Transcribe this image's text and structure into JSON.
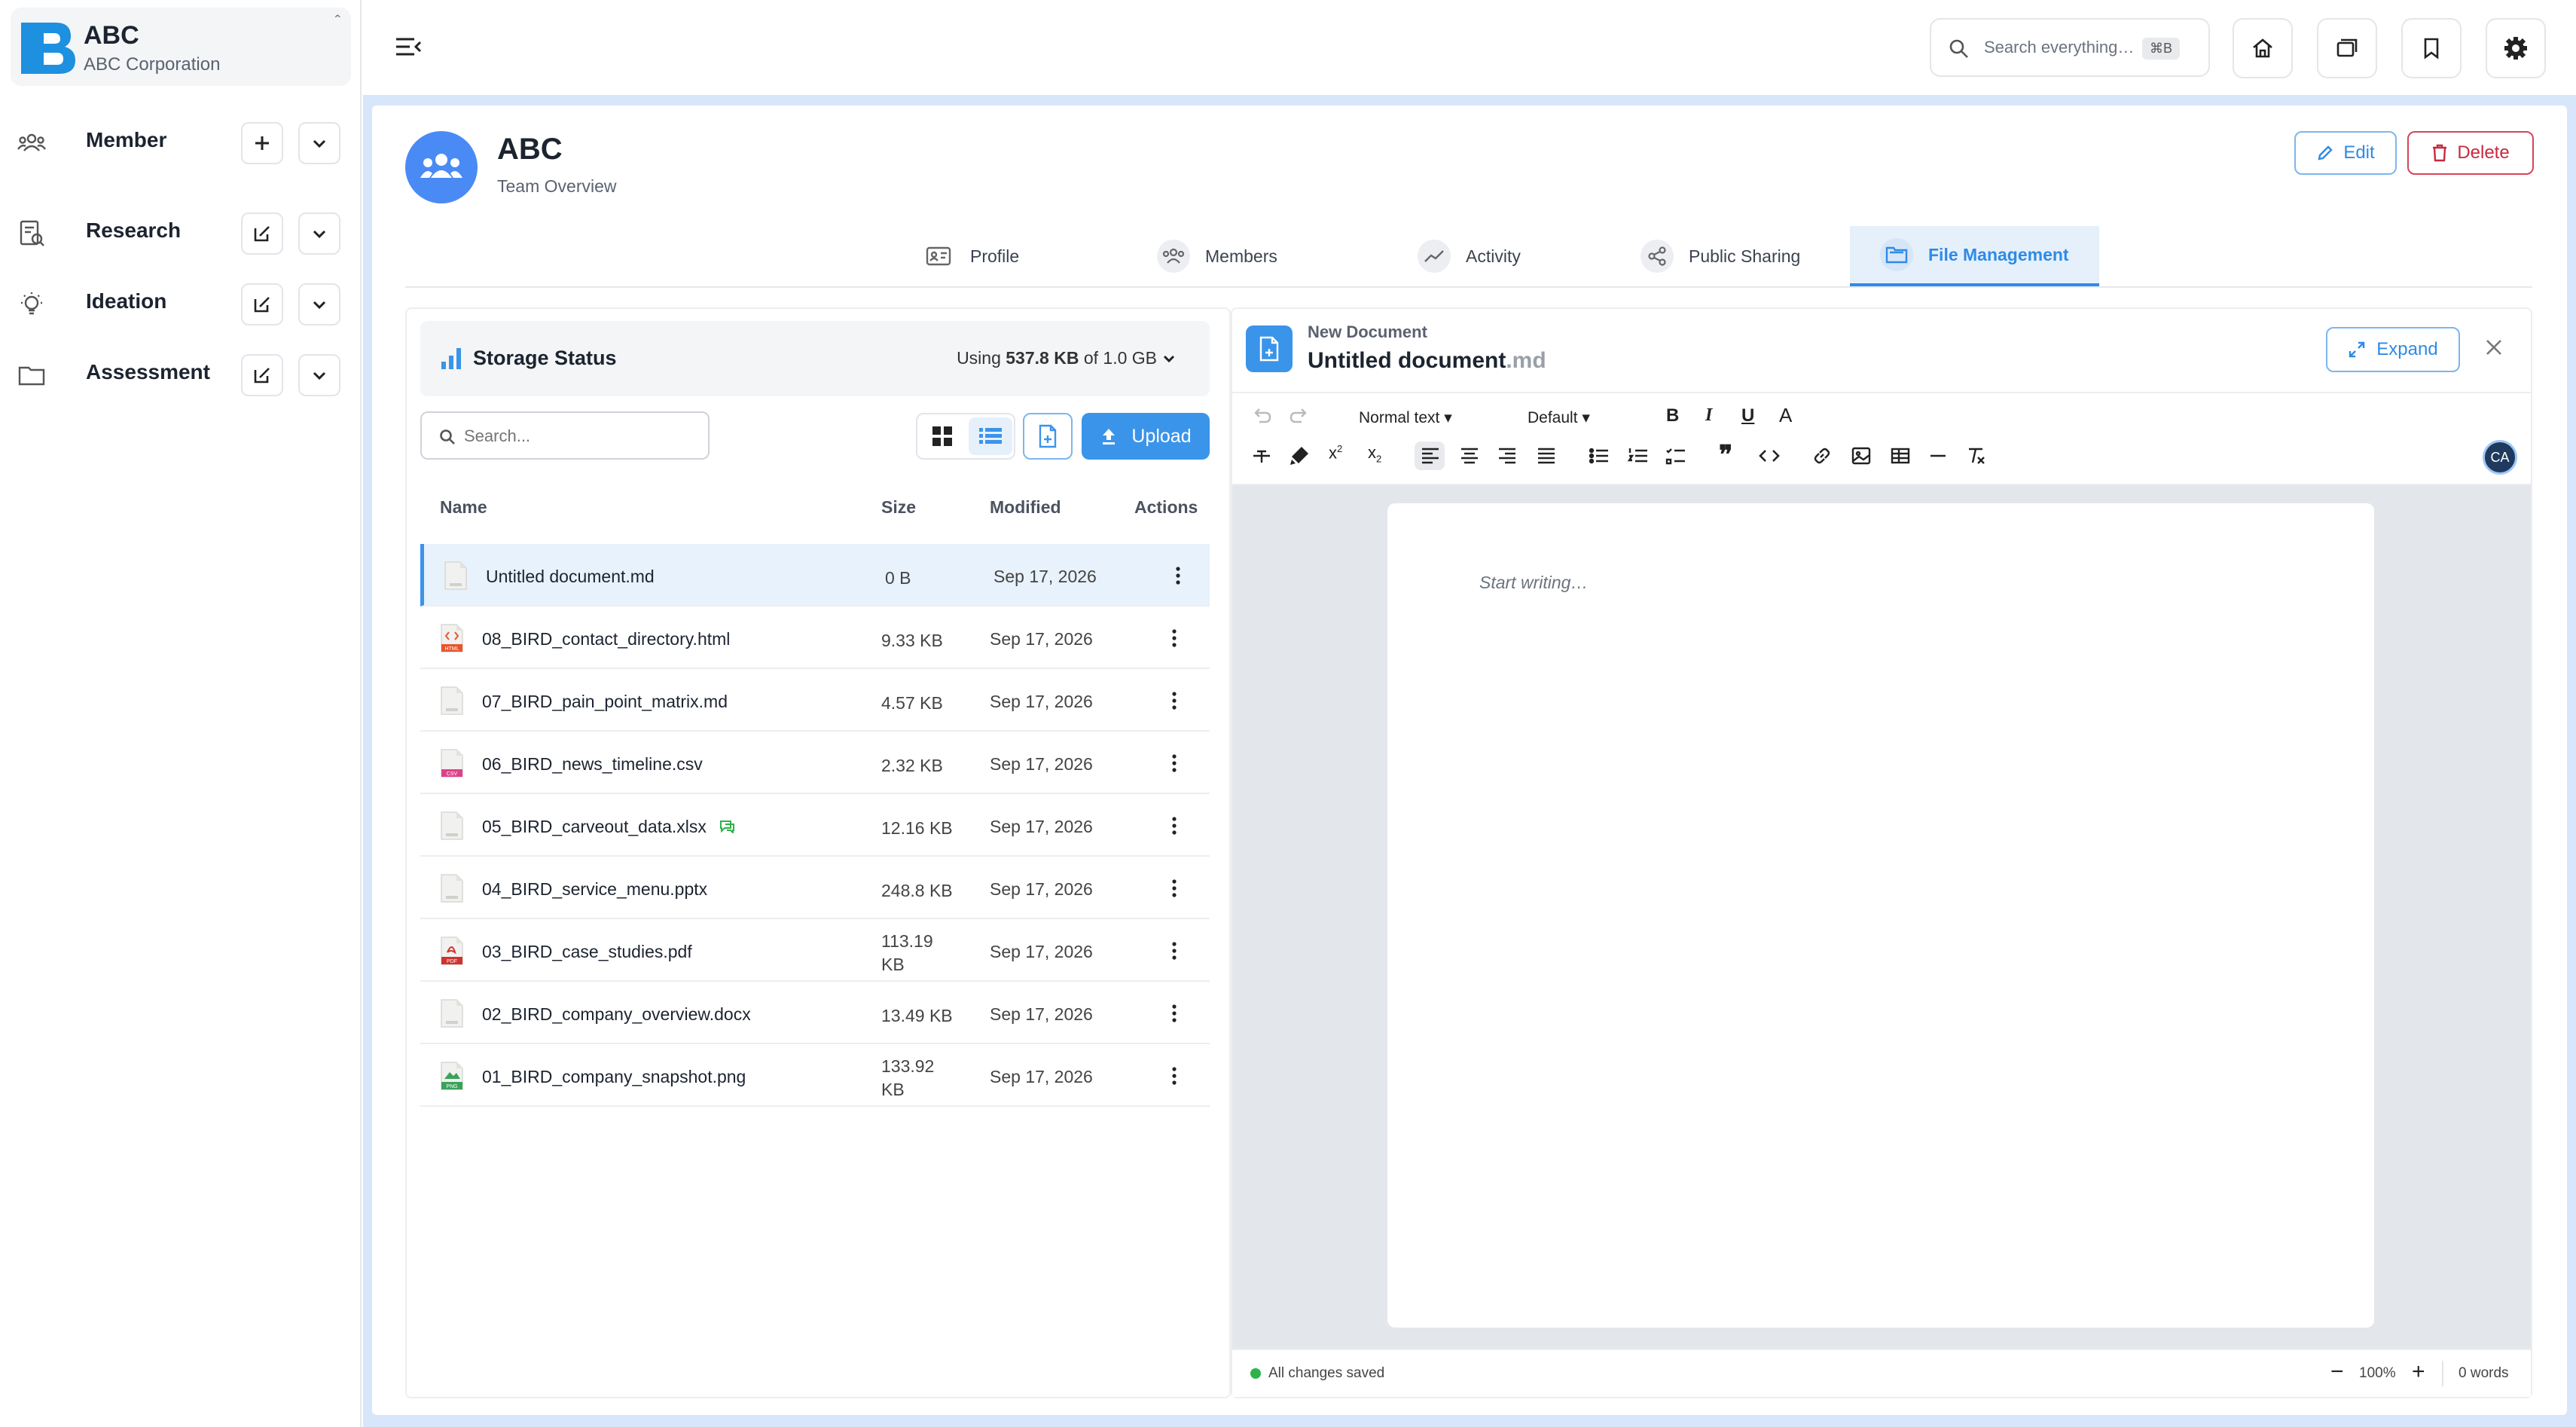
{
  "org": {
    "name": "ABC",
    "subtitle": "ABC Corporation"
  },
  "sidebar": {
    "items": [
      {
        "label": "Member",
        "icon": "people-icon",
        "action_icon": "plus-icon"
      },
      {
        "label": "Research",
        "icon": "report-search-icon",
        "action_icon": "edit-icon"
      },
      {
        "label": "Ideation",
        "icon": "lightbulb-icon",
        "action_icon": "edit-icon"
      },
      {
        "label": "Assessment",
        "icon": "folder-icon",
        "action_icon": "edit-icon"
      }
    ]
  },
  "topbar": {
    "search_placeholder": "Search everything…",
    "search_shortcut": "⌘B"
  },
  "team": {
    "title": "ABC",
    "subtitle": "Team Overview",
    "edit_label": "Edit",
    "delete_label": "Delete"
  },
  "tabs": [
    {
      "label": "Profile",
      "icon": "id-card-icon"
    },
    {
      "label": "Members",
      "icon": "people-icon"
    },
    {
      "label": "Activity",
      "icon": "trend-icon"
    },
    {
      "label": "Public Sharing",
      "icon": "share-icon"
    },
    {
      "label": "File Management",
      "icon": "folder-icon",
      "active": true
    }
  ],
  "storage": {
    "title": "Storage Status",
    "using_prefix": "Using",
    "used": "537.8 KB",
    "of_text": "of 1.0 GB"
  },
  "files_toolbar": {
    "search_placeholder": "Search...",
    "upload_label": "Upload"
  },
  "files_table": {
    "headers": {
      "name": "Name",
      "size": "Size",
      "modified": "Modified",
      "actions": "Actions"
    },
    "rows": [
      {
        "name": "Untitled document.md",
        "size": "0 B",
        "modified": "Sep 17, 2026",
        "type": "generic",
        "selected": true
      },
      {
        "name": "08_BIRD_contact_directory.html",
        "size": "9.33 KB",
        "modified": "Sep 17, 2026",
        "type": "html"
      },
      {
        "name": "07_BIRD_pain_point_matrix.md",
        "size": "4.57 KB",
        "modified": "Sep 17, 2026",
        "type": "generic"
      },
      {
        "name": "06_BIRD_news_timeline.csv",
        "size": "2.32 KB",
        "modified": "Sep 17, 2026",
        "type": "csv"
      },
      {
        "name": "05_BIRD_carveout_data.xlsx",
        "size": "12.16 KB",
        "modified": "Sep 17, 2026",
        "type": "generic",
        "shared": true
      },
      {
        "name": "04_BIRD_service_menu.pptx",
        "size": "248.8 KB",
        "modified": "Sep 17, 2026",
        "type": "generic"
      },
      {
        "name": "03_BIRD_case_studies.pdf",
        "size": "113.19 KB",
        "modified": "Sep 17, 2026",
        "type": "pdf"
      },
      {
        "name": "02_BIRD_company_overview.docx",
        "size": "13.49 KB",
        "modified": "Sep 17, 2026",
        "type": "generic"
      },
      {
        "name": "01_BIRD_company_snapshot.png",
        "size": "133.92 KB",
        "modified": "Sep 17, 2026",
        "type": "png"
      }
    ]
  },
  "editor": {
    "kicker": "New Document",
    "title": "Untitled document",
    "ext": ".md",
    "expand_label": "Expand",
    "text_style": "Normal text",
    "font": "Default",
    "placeholder": "Start writing…",
    "collaborator_initials": "CA",
    "status": "All changes saved",
    "zoom": "100%",
    "words": "0 words"
  },
  "colors": {
    "accent": "#3a94ea",
    "danger": "#c62a40",
    "brand": "#1e90e0",
    "success": "#2cb34a"
  }
}
